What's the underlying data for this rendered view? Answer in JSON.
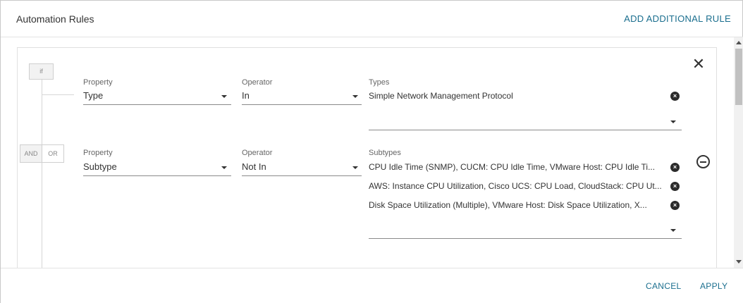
{
  "dialog": {
    "title": "Automation Rules",
    "add_rule_label": "ADD ADDITIONAL RULE"
  },
  "rule": {
    "if_label": "if",
    "and_label": "AND",
    "or_label": "OR",
    "condition1": {
      "property_label": "Property",
      "property_value": "Type",
      "operator_label": "Operator",
      "operator_value": "In",
      "values_label": "Types",
      "values": [
        "Simple Network Management Protocol"
      ]
    },
    "condition2": {
      "property_label": "Property",
      "property_value": "Subtype",
      "operator_label": "Operator",
      "operator_value": "Not In",
      "values_label": "Subtypes",
      "values": [
        "CPU Idle Time (SNMP), CUCM: CPU Idle Time, VMware Host: CPU Idle Ti...",
        "AWS: Instance CPU Utilization, Cisco UCS: CPU Load, CloudStack: CPU Ut...",
        "Disk Space Utilization (Multiple), VMware Host: Disk Space Utilization, X..."
      ]
    }
  },
  "icons": {
    "close": "close-icon",
    "remove": "minus-circle-icon",
    "chip_remove": "x-circle-icon",
    "dropdown": "caret-down-icon"
  },
  "footer": {
    "cancel_label": "CANCEL",
    "apply_label": "APPLY"
  },
  "colors": {
    "accent": "#1a6e8e"
  }
}
